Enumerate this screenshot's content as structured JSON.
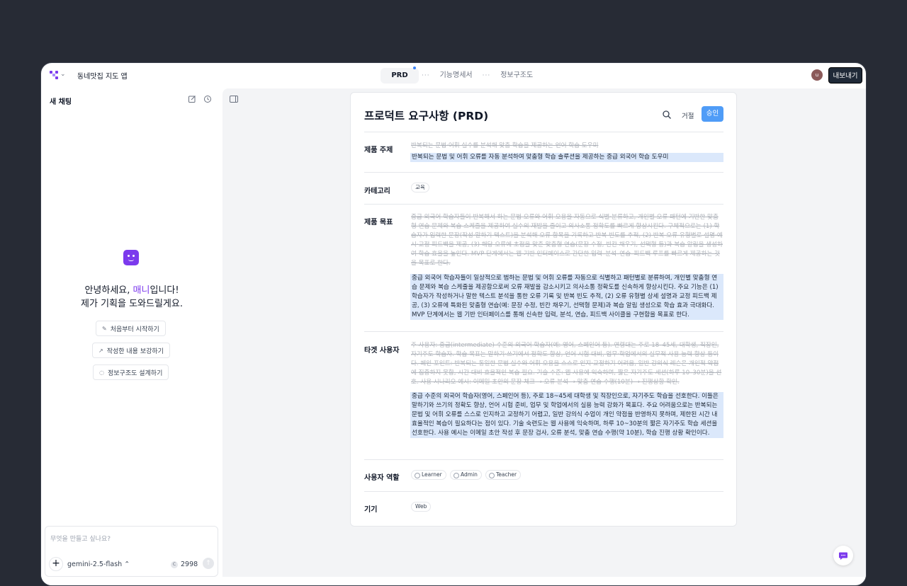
{
  "app": {
    "title": "동네맛집 지도 앱",
    "export_label": "내보내기",
    "avatar_initial": "u"
  },
  "tabs": [
    {
      "label": "PRD",
      "active": true
    },
    {
      "label": "기능명세서",
      "active": false
    },
    {
      "label": "정보구조도",
      "active": false
    }
  ],
  "sidebar": {
    "title": "새 채팅",
    "greeting_prefix": "안녕하세요, ",
    "greeting_name": "매니",
    "greeting_suffix": "입니다!",
    "greeting_line2": "제가 기획을 도와드릴게요.",
    "suggestions": [
      {
        "label": "처음부터 시작하기",
        "icon": "edit-icon"
      },
      {
        "label": "작성한 내용 보강하기",
        "icon": "arrow-up-right-icon"
      },
      {
        "label": "정보구조도 설계하기",
        "icon": "loader-icon"
      }
    ],
    "composer": {
      "placeholder": "무엇을 만들고 싶나요?",
      "model": "gemini-2.5-flash",
      "credits": "2998"
    }
  },
  "doc": {
    "title": "프로덕트 요구사항 (PRD)",
    "reject_label": "거절",
    "approve_label": "승인",
    "sections": {
      "topic": {
        "label": "제품 주제",
        "old": "반복되는 문법·어휘 실수를 분석해 맞춤 학습을 제공하는 언어 학습 도우미",
        "new": "반복되는 문법 및 어휘 오류를 자동 분석하여 맞춤형 학습 솔루션을 제공하는 중급 외국어 학습 도우미"
      },
      "category": {
        "label": "카테고리",
        "chip": "교육"
      },
      "goal": {
        "label": "제품 목표",
        "old": "중급 외국어 학습자들이 반복해서 하는 문법 오류와 어휘 오용을 자동으로 식별·분류하고, 개인별 오류 패턴에 기반한 맞춤형 연습 문제와 복습 스케줄을 제공하여 실수의 재발을 줄이고 의사소통 정확도를 빠르게 향상시킨다. 구체적으로는 (1) 학습자가 입력한 문장(작성·말하기 텍스트)을 분석해 오류 항목을 기록하고 반복 빈도를 추적, (2) 반복 오류 유형별로 설명·예시·교정 피드백을 제공, (3) 해당 오류에 초점을 맞춘 맞춤형 연습(문장 수정, 빈칸 채우기, 선택형 등)과 복습 알림을 생성하여 학습 효율을 높인다. MVP 단계에서는 웹 기반 인터페이스로 간단한 입력–분석–연습–피드백 루프를 빠르게 제공하는 것을 목표로 한다.",
        "new": "중급 외국어 학습자들이 일상적으로 범하는 문법 및 어휘 오류를 자동으로 식별하고 패턴별로 분류하여, 개인별 맞춤형 연습 문제와 복습 스케줄을 제공함으로써 오류 재발을 감소시키고 의사소통 정확도를 신속하게 향상시킨다. 주요 기능은 (1) 학습자가 작성하거나 말한 텍스트 분석을 통한 오류 기록 및 반복 빈도 추적, (2) 오류 유형별 상세 설명과 교정 피드백 제공, (3) 오류에 특화된 맞춤형 연습(예: 문장 수정, 빈칸 채우기, 선택형 문제)과 복습 알림 생성으로 학습 효과 극대화다. MVP 단계에서는 웹 기반 인터페이스를 통해 신속한 입력, 분석, 연습, 피드백 사이클을 구현함을 목표로 한다."
      },
      "target": {
        "label": "타겟 사용자",
        "old": "주 사용자: 중급(intermediate) 수준의 외국어 학습자(예: 영어, 스페인어 등). 연령대는 주로 18–45세, 대학생, 직장인, 자기주도 학습자. 학습 목표는 말하기·쓰기에서 정확도 향상, 언어 시험 대비, 업무·학업에서의 실무적 사용 능력 향상 등이다. 페인 포인트: 반복되는 동일한 문법 실수와 어휘 오용을 스스로 인지·교정하기 어려움, 일반 강의식 레슨은 개인적 약점에 집중하지 못함, 시간 대비 효율적인 복습 필요. 기술 수준: 웹 사용에 익숙하며, 짧은 자기주도 세션(하루 10–30분)을 선호. 사용 시나리오 예시: 이메일 초안의 문장 체크 → 오류 분석 → 맞춤 연습 수행(10분) → 진행상황 확인.",
        "new": "중급 수준의 외국어 학습자(영어, 스페인어 등), 주로 18~45세 대학생 및 직장인으로, 자기주도 학습을 선호한다. 이들은 말하기와 쓰기의 정확도 향상, 언어 시험 준비, 업무 및 학업에서의 실용 능력 강화가 목표다. 주요 어려움으로는 반복되는 문법 및 어휘 오류를 스스로 인지하고 교정하기 어렵고, 일반 강의식 수업이 개인 약점을 반영하지 못하며, 제한된 시간 내 효율적인 복습이 필요하다는 점이 있다. 기술 숙련도는 웹 사용에 익숙하며, 하루 10~30분의 짧은 자기주도 학습 세션을 선호한다. 사용 예시는 이메일 초안 작성 후 문장 검사, 오류 분석, 맞춤 연습 수행(약 10분), 학습 진행 상황 확인이다."
      },
      "roles": {
        "label": "사용자 역할",
        "chips": [
          "Learner",
          "Admin",
          "Teacher"
        ]
      },
      "device": {
        "label": "기기",
        "chip": "Web"
      }
    }
  },
  "colors": {
    "accent": "#7c3aed",
    "approve": "#4f9cf7",
    "highlight": "#dbe8fb"
  }
}
